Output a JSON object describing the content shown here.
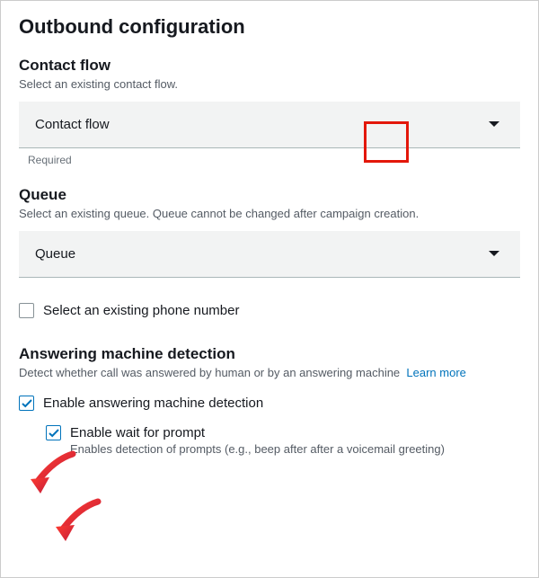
{
  "page_title": "Outbound configuration",
  "contact_flow": {
    "title": "Contact flow",
    "desc": "Select an existing contact flow.",
    "placeholder": "Contact flow",
    "hint": "Required"
  },
  "queue": {
    "title": "Queue",
    "desc": "Select an existing queue. Queue cannot be changed after campaign creation.",
    "placeholder": "Queue"
  },
  "phone_checkbox": {
    "label": "Select an existing phone number"
  },
  "amd": {
    "title": "Answering machine detection",
    "desc": "Detect whether call was answered by human or by an answering machine",
    "learn_more": "Learn more",
    "enable_label": "Enable answering machine detection",
    "wait_label": "Enable wait for prompt",
    "wait_desc": "Enables detection of prompts (e.g., beep after after a voicemail greeting)"
  }
}
